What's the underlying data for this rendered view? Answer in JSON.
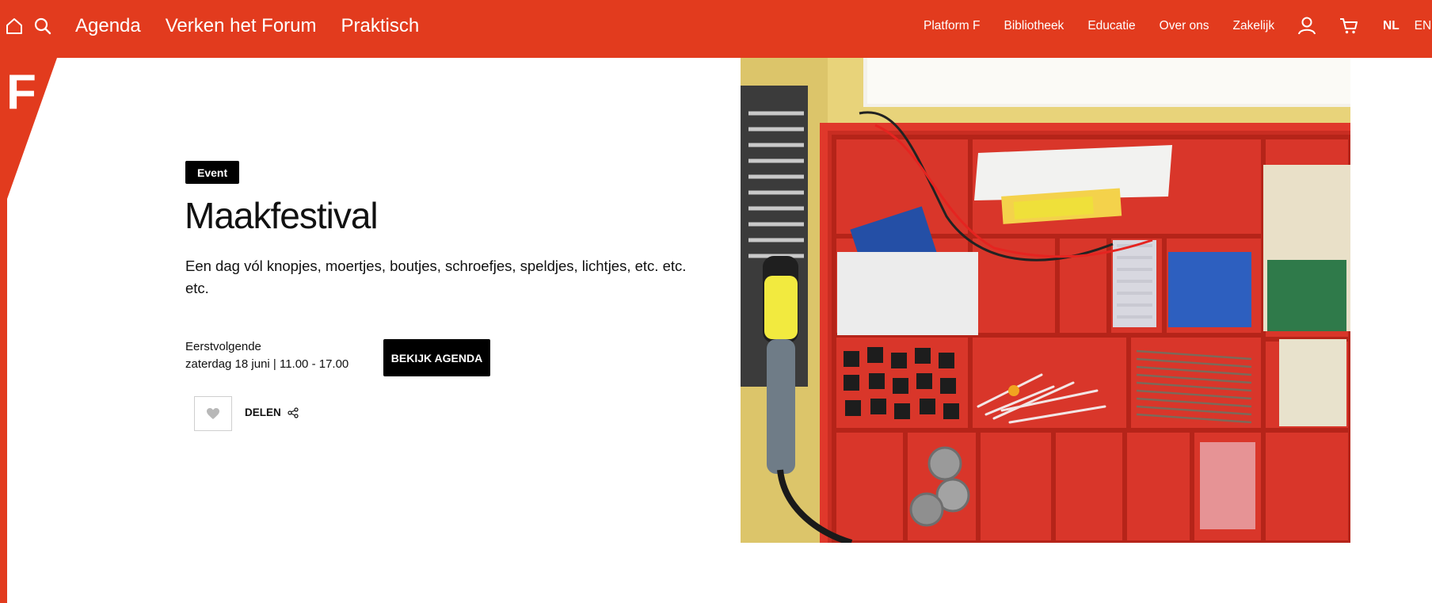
{
  "header": {
    "home_icon": "home-icon",
    "search_icon": "search-icon",
    "main_nav": [
      "Agenda",
      "Verken het Forum",
      "Praktisch"
    ],
    "secondary_nav": [
      "Platform F",
      "Bibliotheek",
      "Educatie",
      "Over ons",
      "Zakelijk"
    ],
    "account_icon": "user-icon",
    "cart_icon": "cart-icon",
    "languages": [
      "NL",
      "EN"
    ],
    "active_language": "NL"
  },
  "logo": {
    "letter": "F"
  },
  "event": {
    "badge": "Event",
    "title": "Maakfestival",
    "description": "Een dag vól knopjes, moertjes, boutjes, schroefjes, speldjes, lichtjes, etc. etc. etc.",
    "next_label": "Eerstvolgende",
    "next_date": "zaterdag 18 juni | 11.00 - 17.00",
    "agenda_button": "BEKIJK AGENDA",
    "favorite_icon": "heart-icon",
    "share_label": "DELEN",
    "share_icon": "share-icon"
  },
  "colors": {
    "brand": "#e23b1e",
    "button": "#000000",
    "text": "#111111"
  }
}
